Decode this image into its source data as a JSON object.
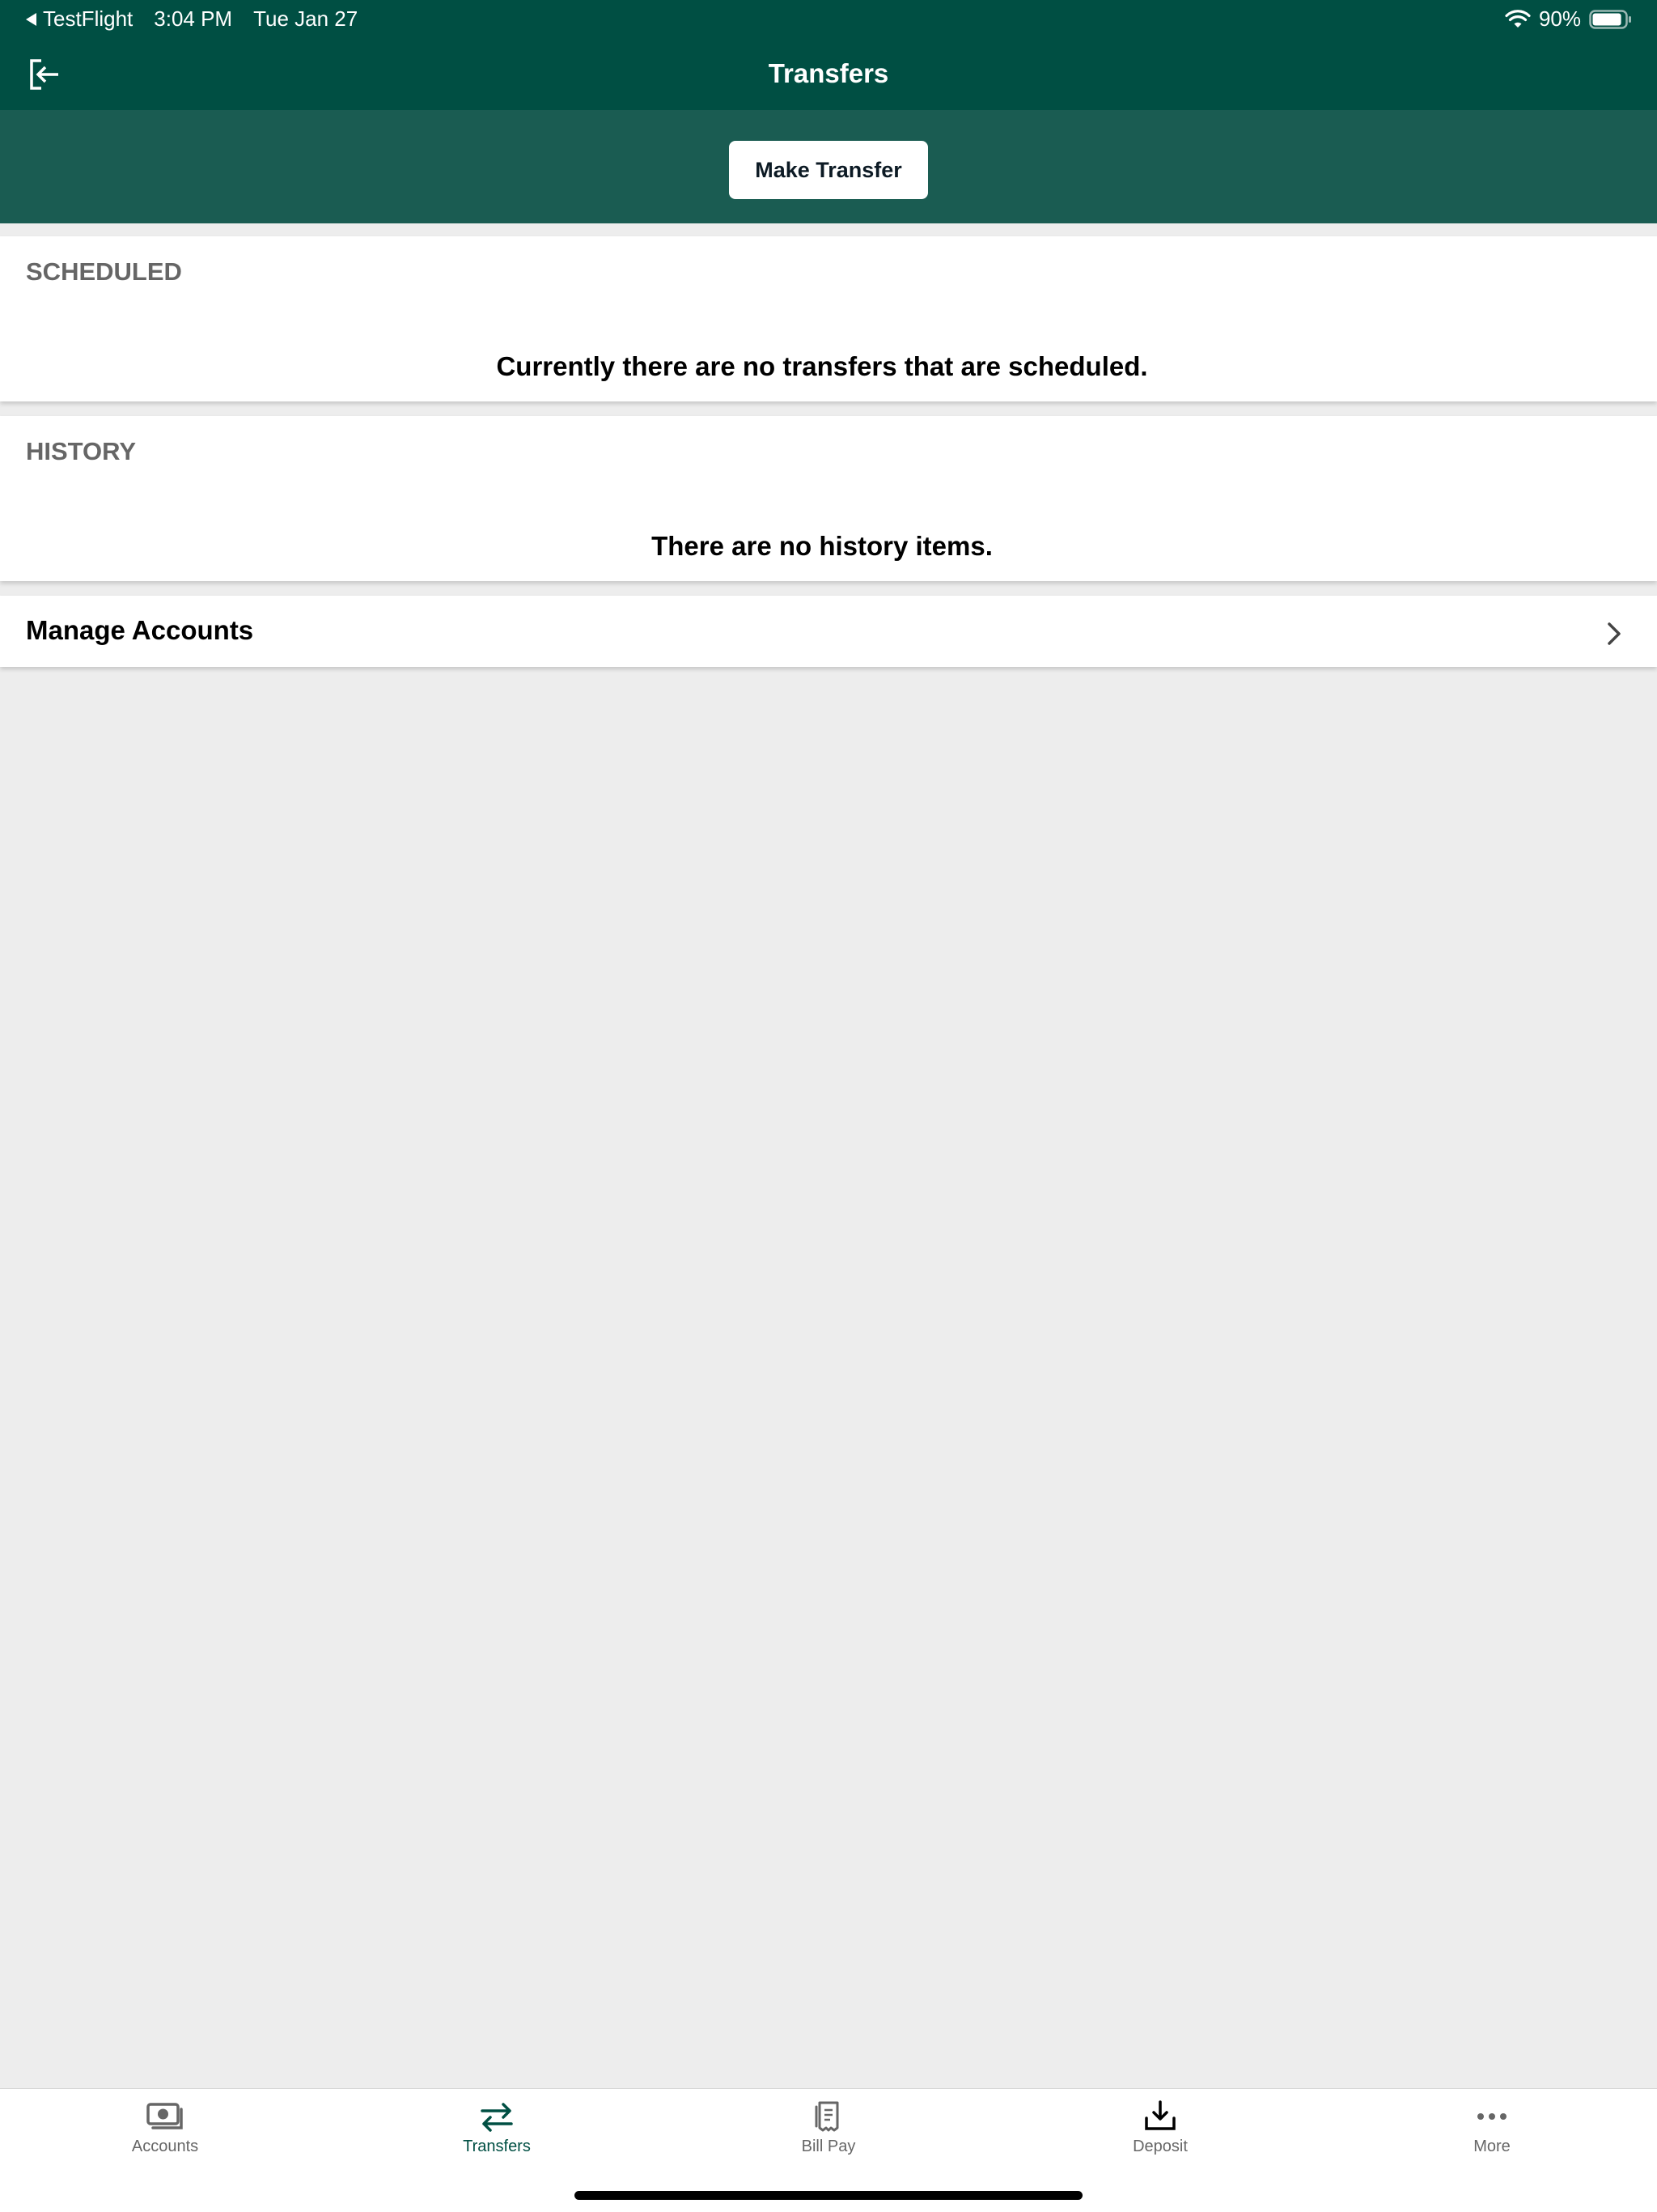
{
  "status_bar": {
    "back_app": "TestFlight",
    "time": "3:04 PM",
    "date": "Tue Jan 27",
    "battery": "90%",
    "battery_level": 0.9,
    "icons": [
      "wifi-icon",
      "battery-icon",
      "back-triangle-icon"
    ]
  },
  "nav": {
    "title": "Transfers",
    "logout_icon": "logout-icon"
  },
  "action": {
    "make_transfer_label": "Make Transfer"
  },
  "scheduled": {
    "header": "SCHEDULED",
    "empty_message": "Currently there are no transfers that are scheduled."
  },
  "history": {
    "header": "HISTORY",
    "empty_message": "There are no history items."
  },
  "manage_accounts": {
    "label": "Manage Accounts",
    "icon": "chevron-right-icon"
  },
  "tabs": [
    {
      "label": "Accounts",
      "icon": "cash-icon",
      "active": false
    },
    {
      "label": "Transfers",
      "icon": "transfer-arrows-icon",
      "active": true
    },
    {
      "label": "Bill Pay",
      "icon": "receipt-icon",
      "active": false
    },
    {
      "label": "Deposit",
      "icon": "download-tray-icon",
      "active": false
    },
    {
      "label": "More",
      "icon": "more-dots-icon",
      "active": false
    }
  ],
  "colors": {
    "header_bg": "#004f43",
    "action_band_bg": "#1a5c52",
    "page_bg": "#ededed",
    "active_tab": "#004f43",
    "inactive_tab": "#666666"
  }
}
